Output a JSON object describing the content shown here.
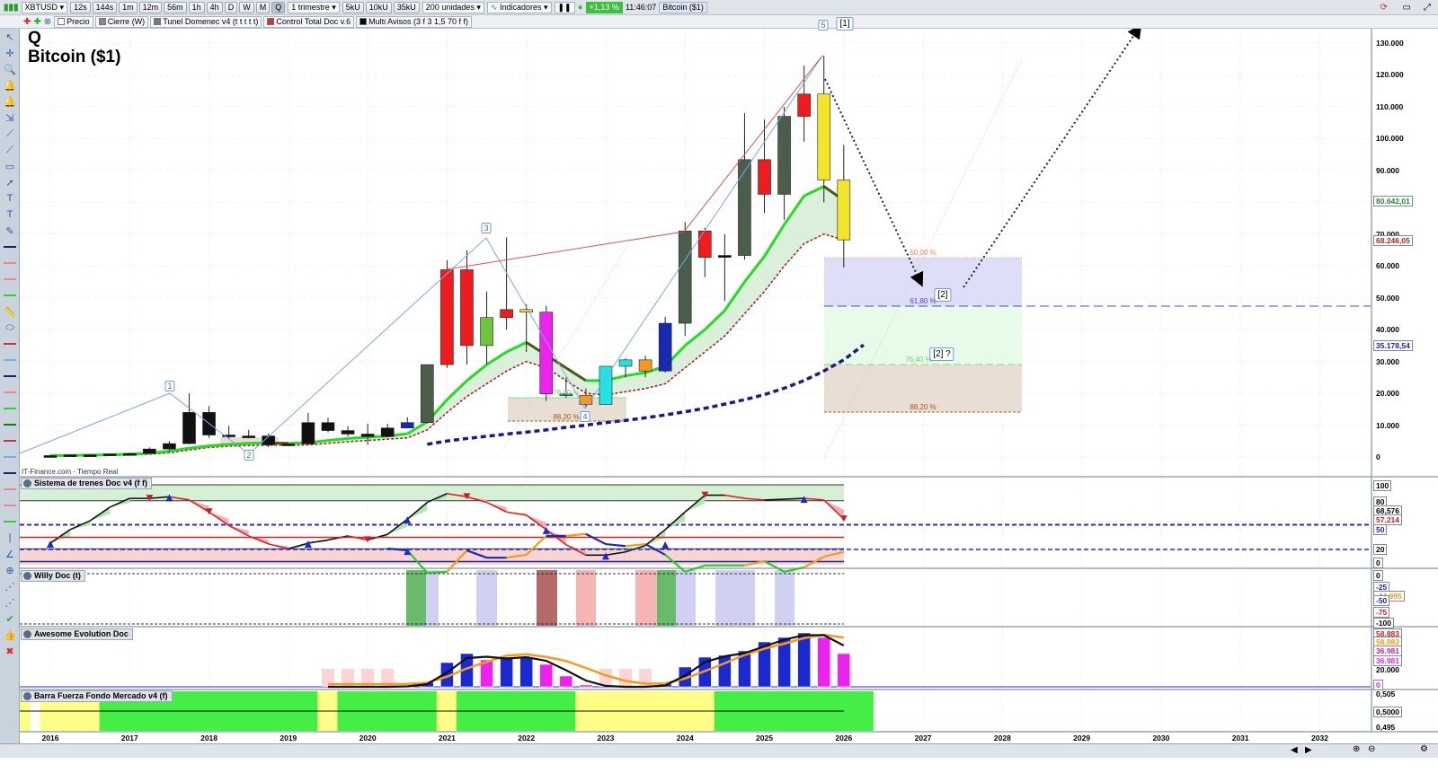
{
  "toolbar": {
    "symbol": "XBTUSD",
    "intervals": [
      "12s",
      "144s",
      "1m",
      "12m",
      "56m",
      "1h",
      "4h",
      "D",
      "W",
      "M",
      "Q"
    ],
    "period": "1 trimestre",
    "volumes": [
      "5kU",
      "10kU",
      "35kU"
    ],
    "units": "200 unidades",
    "indicators": "Indicadores",
    "change": "+1,13 %",
    "time": "11:46:07",
    "instrument": "Bitcoin ($1)"
  },
  "legend_bar": [
    "Precio",
    "Cierre (W)",
    "Tunel Domenec v4 (t t t t t)",
    "Control Total Doc v.6",
    "Multi Avisos (3 f 3 1,5 70 f f)"
  ],
  "chart_title": {
    "period": "Q",
    "name": "Bitcoin ($1)"
  },
  "source": "IT-Finance.com - Tiempo Real",
  "panels": [
    "Sistema de trenes Doc v4 (f f)",
    "Willy Doc (t)",
    "Awesome Evolution Doc",
    "Barra Fuerza Fondo Mercado v4 (f)"
  ],
  "price_axis": [
    "130.000",
    "120.000",
    "110.000",
    "100.000",
    "90.000",
    "70.000",
    "60.000",
    "50.000",
    "40.000",
    "30.000",
    "20.000",
    "10.000",
    "0"
  ],
  "price_tags": {
    "green": "80.642,01",
    "red": "68.246,05",
    "blue": "35.178,54"
  },
  "trenes_axis": [
    "100",
    "80",
    "68,576",
    "57,214",
    "50",
    "20",
    "0"
  ],
  "willy_axis": [
    "0",
    "-25",
    "-44,995",
    "-50",
    "-75",
    "-100"
  ],
  "awesome_axis": [
    "58.883",
    "58.883",
    "36.981",
    "36.981",
    "20.000",
    "0"
  ],
  "barra_axis": [
    "0,505",
    "0,5000",
    "0,495"
  ],
  "years": [
    "2016",
    "2017",
    "2018",
    "2019",
    "2020",
    "2021",
    "2022",
    "2023",
    "2024",
    "2025",
    "2026",
    "2027",
    "2028",
    "2029",
    "2030",
    "2031",
    "2032"
  ],
  "waves": [
    "1",
    "2",
    "3",
    "4",
    "5",
    "[1]",
    "[2]",
    "[2] ?"
  ],
  "fib_main": [
    "50,00 %",
    "61,80 %",
    "76,40 %",
    "88,20 %"
  ],
  "fib_small": [
    "76,40 %",
    "88,20 %"
  ],
  "colors": {
    "green": "#22dd22",
    "red_line": "#cc2222",
    "navy": "#1a1a8c"
  },
  "chart_data": {
    "type": "candlestick",
    "title": "Bitcoin ($1)",
    "interval": "quarterly",
    "start": "2016Q1",
    "unit": "USD thousands",
    "ylim": [
      0,
      130
    ],
    "candles": [
      [
        0.43,
        0.5,
        0.37,
        0.42,
        "k"
      ],
      [
        0.42,
        0.78,
        0.42,
        0.67,
        "k"
      ],
      [
        0.67,
        0.77,
        0.58,
        0.61,
        "k"
      ],
      [
        0.61,
        1.0,
        0.6,
        0.96,
        "k"
      ],
      [
        0.96,
        1.3,
        0.9,
        1.07,
        "k"
      ],
      [
        1.07,
        3.0,
        1.0,
        2.5,
        "k"
      ],
      [
        2.5,
        5.0,
        1.8,
        4.2,
        "k"
      ],
      [
        4.2,
        20,
        4.0,
        14,
        "k"
      ],
      [
        14,
        16,
        6.0,
        6.9,
        "k"
      ],
      [
        6.9,
        9.8,
        5.8,
        6.4,
        "k"
      ],
      [
        6.4,
        8.5,
        5.9,
        6.6,
        "k"
      ],
      [
        6.6,
        7.4,
        3.1,
        3.8,
        "k"
      ],
      [
        3.8,
        4.2,
        3.4,
        4.1,
        "k"
      ],
      [
        4.1,
        13.8,
        4.0,
        10.8,
        "k"
      ],
      [
        10.8,
        12.3,
        7.7,
        8.3,
        "k"
      ],
      [
        8.3,
        9.7,
        6.5,
        7.2,
        "k"
      ],
      [
        7.2,
        10.5,
        3.8,
        6.4,
        "k"
      ],
      [
        6.4,
        10.4,
        6.2,
        9.1,
        "k"
      ],
      [
        9.1,
        12.5,
        9.0,
        10.8,
        "b"
      ],
      [
        10.8,
        29,
        10.5,
        29,
        "dg"
      ],
      [
        29,
        61.8,
        28,
        58.8,
        "r"
      ],
      [
        58.8,
        64.9,
        29,
        35,
        "r"
      ],
      [
        35,
        52,
        29,
        43.8,
        "lg"
      ],
      [
        43.8,
        69,
        40,
        46.3,
        "r"
      ],
      [
        46.3,
        48,
        33,
        45.5,
        "y"
      ],
      [
        45.5,
        47.5,
        17.6,
        19.8,
        "m"
      ],
      [
        19.8,
        25,
        18.6,
        19.4,
        "t"
      ],
      [
        19.4,
        21.5,
        15.5,
        16.5,
        "o"
      ],
      [
        16.5,
        28.5,
        16.5,
        28.5,
        "c"
      ],
      [
        28.5,
        31,
        25,
        30.5,
        "c"
      ],
      [
        30.5,
        31.8,
        25,
        27,
        "o"
      ],
      [
        27,
        44,
        26.5,
        42,
        "b"
      ],
      [
        42,
        73.8,
        38,
        71,
        "dg"
      ],
      [
        71,
        72,
        56.5,
        62.7,
        "r"
      ],
      [
        62.7,
        70,
        49,
        63.3,
        "k"
      ],
      [
        63.3,
        108,
        62,
        93.4,
        "dg"
      ],
      [
        93.4,
        106,
        76.6,
        82.5,
        "r"
      ],
      [
        82.5,
        110,
        74.5,
        107,
        "dg"
      ],
      [
        107,
        123,
        99,
        114,
        "r"
      ],
      [
        114,
        126,
        80,
        87,
        "y"
      ],
      [
        87,
        98,
        59.5,
        68.2,
        "y"
      ]
    ],
    "ema_green": [
      0.5,
      0.5,
      0.6,
      0.7,
      0.9,
      1.2,
      1.8,
      2.8,
      3.5,
      4.0,
      4.3,
      4.4,
      4.3,
      4.5,
      5.2,
      5.8,
      6.2,
      6.6,
      7.3,
      11,
      18,
      24,
      29,
      33,
      36,
      32,
      28,
      24,
      24,
      25.5,
      26.5,
      28.5,
      35,
      40,
      46,
      55,
      63,
      73,
      82,
      85,
      80.6
    ],
    "band_red": [
      0.3,
      0.3,
      0.4,
      0.5,
      0.6,
      0.9,
      1.3,
      2.2,
      3.0,
      3.4,
      3.6,
      3.7,
      3.7,
      3.8,
      4.3,
      4.8,
      5.2,
      5.6,
      6.0,
      8.5,
      14,
      19,
      23,
      27,
      30,
      28,
      24,
      20,
      19.5,
      20.5,
      21.5,
      23,
      28,
      33,
      38,
      45,
      52,
      60,
      67,
      70,
      68.2
    ],
    "navy_trend": {
      "start": 19,
      "values": [
        4,
        5,
        5.8,
        6.5,
        7.2,
        7.8,
        8.5,
        9.3,
        10,
        10.8,
        11.5,
        12.3,
        13.2,
        14.2,
        15.3,
        16.6,
        18,
        19.6,
        21.6,
        24,
        27,
        30.5,
        35.2
      ]
    },
    "trenes": [
      27,
      44,
      55,
      72,
      83,
      83,
      85,
      81,
      66,
      49,
      36,
      26,
      20,
      27,
      31,
      36,
      31,
      38,
      57,
      78,
      89,
      85,
      78,
      66,
      62,
      44,
      25,
      12,
      12,
      16,
      24,
      44,
      66,
      87,
      87,
      83,
      81,
      82,
      83,
      81,
      57.2
    ],
    "willy": {
      "start": 17,
      "values": [
        -52,
        -48,
        -2,
        -4,
        -48,
        -33,
        -33,
        -39,
        -78,
        -78,
        -82,
        -61,
        -57,
        -61,
        -39,
        -4,
        -17,
        -17,
        -17,
        -26,
        -4,
        -13,
        -35,
        -45
      ]
    },
    "awesome": {
      "start": 14,
      "values": [
        0,
        0,
        0,
        0,
        1,
        5,
        27,
        37,
        30,
        33,
        33,
        25,
        12,
        2,
        0,
        0,
        0,
        3,
        22,
        33,
        35,
        40,
        50,
        55,
        60,
        55,
        37
      ]
    },
    "barra_yellow_quarters": [
      0,
      1,
      13,
      19,
      26,
      27,
      28,
      29,
      30,
      31,
      32
    ]
  }
}
